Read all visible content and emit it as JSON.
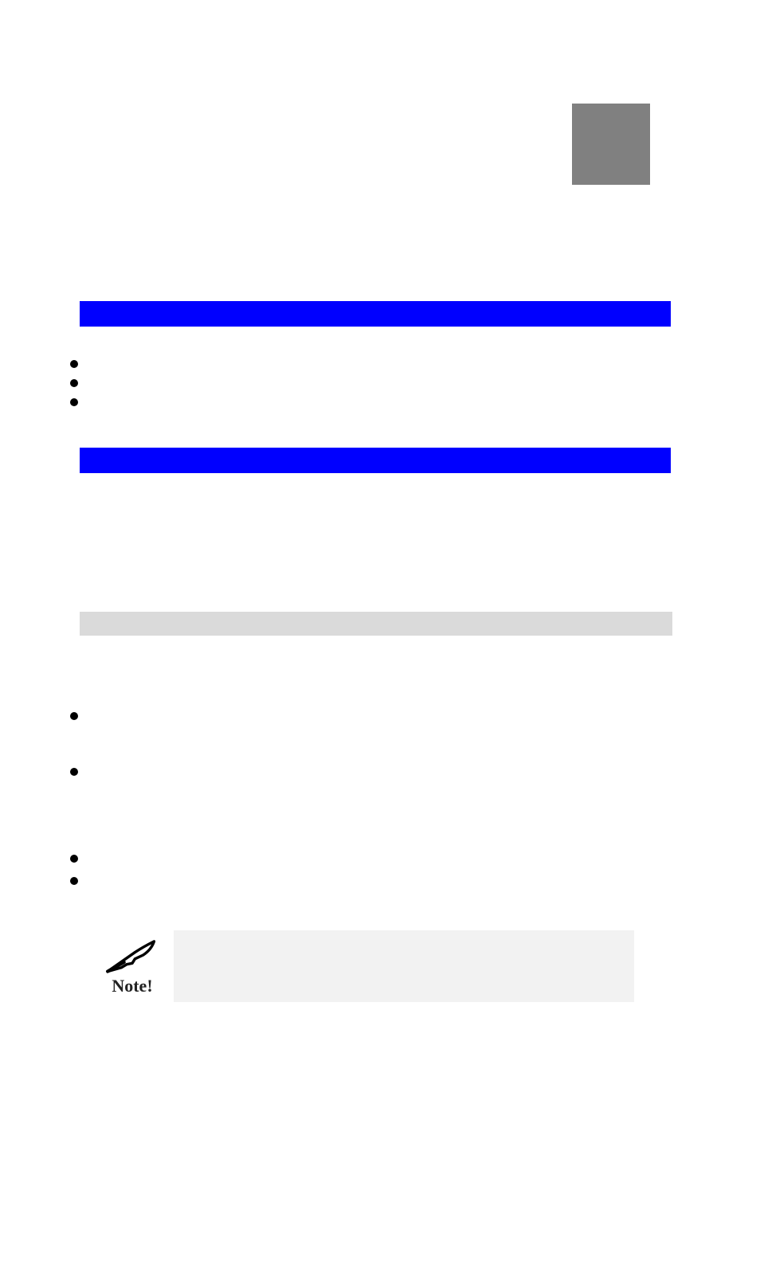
{
  "note": {
    "label": "Note!"
  }
}
